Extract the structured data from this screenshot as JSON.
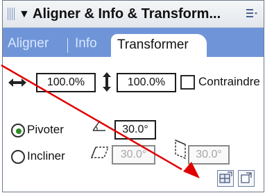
{
  "panel": {
    "title": "Aligner & Info & Transform...",
    "tabs": [
      {
        "label": "Aligner",
        "active": false
      },
      {
        "label": "Info",
        "active": false
      },
      {
        "label": "Transformer",
        "active": true
      }
    ]
  },
  "scale": {
    "width_value": "100.0%",
    "height_value": "100.0%",
    "constrain_label": "Contraindre",
    "constrain_checked": false
  },
  "rotate": {
    "label": "Pivoter",
    "value": "30.0°",
    "selected": true
  },
  "skew": {
    "label": "Incliner",
    "horizontal_value": "30.0°",
    "vertical_value": "30.0°",
    "selected": false
  },
  "icons": {
    "collapse": "triangle-down-icon",
    "menu": "panel-menu-icon",
    "width": "horizontal-scale-icon",
    "height": "vertical-scale-icon",
    "rotate": "rotate-angle-icon",
    "skew_h": "skew-horizontal-icon",
    "skew_v": "skew-vertical-icon",
    "copy_transform": "copy-transform-icon",
    "reset_transform": "reset-transform-icon"
  },
  "colors": {
    "tab_bar": "#6f95d8",
    "annotation_red": "#e00000",
    "radio_selected": "#2b8d1f"
  }
}
